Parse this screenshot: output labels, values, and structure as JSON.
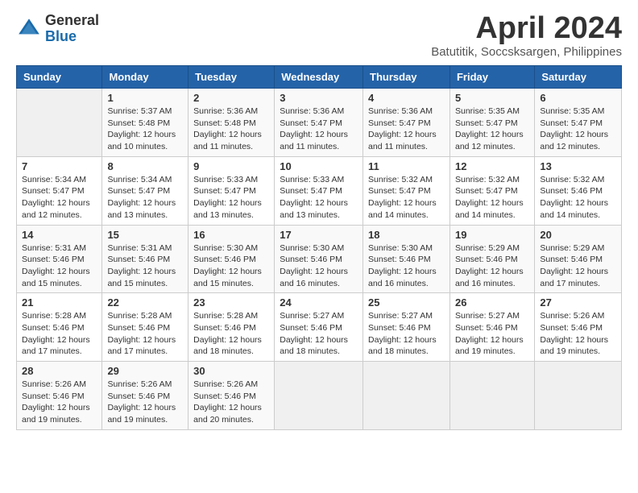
{
  "header": {
    "logo_general": "General",
    "logo_blue": "Blue",
    "month_year": "April 2024",
    "location": "Batutitik, Soccsksargen, Philippines"
  },
  "days_of_week": [
    "Sunday",
    "Monday",
    "Tuesday",
    "Wednesday",
    "Thursday",
    "Friday",
    "Saturday"
  ],
  "weeks": [
    [
      {
        "day": "",
        "empty": true
      },
      {
        "day": "1",
        "sunrise": "5:37 AM",
        "sunset": "5:48 PM",
        "daylight": "12 hours and 10 minutes."
      },
      {
        "day": "2",
        "sunrise": "5:36 AM",
        "sunset": "5:48 PM",
        "daylight": "12 hours and 11 minutes."
      },
      {
        "day": "3",
        "sunrise": "5:36 AM",
        "sunset": "5:47 PM",
        "daylight": "12 hours and 11 minutes."
      },
      {
        "day": "4",
        "sunrise": "5:36 AM",
        "sunset": "5:47 PM",
        "daylight": "12 hours and 11 minutes."
      },
      {
        "day": "5",
        "sunrise": "5:35 AM",
        "sunset": "5:47 PM",
        "daylight": "12 hours and 12 minutes."
      },
      {
        "day": "6",
        "sunrise": "5:35 AM",
        "sunset": "5:47 PM",
        "daylight": "12 hours and 12 minutes."
      }
    ],
    [
      {
        "day": "7",
        "sunrise": "5:34 AM",
        "sunset": "5:47 PM",
        "daylight": "12 hours and 12 minutes."
      },
      {
        "day": "8",
        "sunrise": "5:34 AM",
        "sunset": "5:47 PM",
        "daylight": "12 hours and 13 minutes."
      },
      {
        "day": "9",
        "sunrise": "5:33 AM",
        "sunset": "5:47 PM",
        "daylight": "12 hours and 13 minutes."
      },
      {
        "day": "10",
        "sunrise": "5:33 AM",
        "sunset": "5:47 PM",
        "daylight": "12 hours and 13 minutes."
      },
      {
        "day": "11",
        "sunrise": "5:32 AM",
        "sunset": "5:47 PM",
        "daylight": "12 hours and 14 minutes."
      },
      {
        "day": "12",
        "sunrise": "5:32 AM",
        "sunset": "5:47 PM",
        "daylight": "12 hours and 14 minutes."
      },
      {
        "day": "13",
        "sunrise": "5:32 AM",
        "sunset": "5:46 PM",
        "daylight": "12 hours and 14 minutes."
      }
    ],
    [
      {
        "day": "14",
        "sunrise": "5:31 AM",
        "sunset": "5:46 PM",
        "daylight": "12 hours and 15 minutes."
      },
      {
        "day": "15",
        "sunrise": "5:31 AM",
        "sunset": "5:46 PM",
        "daylight": "12 hours and 15 minutes."
      },
      {
        "day": "16",
        "sunrise": "5:30 AM",
        "sunset": "5:46 PM",
        "daylight": "12 hours and 15 minutes."
      },
      {
        "day": "17",
        "sunrise": "5:30 AM",
        "sunset": "5:46 PM",
        "daylight": "12 hours and 16 minutes."
      },
      {
        "day": "18",
        "sunrise": "5:30 AM",
        "sunset": "5:46 PM",
        "daylight": "12 hours and 16 minutes."
      },
      {
        "day": "19",
        "sunrise": "5:29 AM",
        "sunset": "5:46 PM",
        "daylight": "12 hours and 16 minutes."
      },
      {
        "day": "20",
        "sunrise": "5:29 AM",
        "sunset": "5:46 PM",
        "daylight": "12 hours and 17 minutes."
      }
    ],
    [
      {
        "day": "21",
        "sunrise": "5:28 AM",
        "sunset": "5:46 PM",
        "daylight": "12 hours and 17 minutes."
      },
      {
        "day": "22",
        "sunrise": "5:28 AM",
        "sunset": "5:46 PM",
        "daylight": "12 hours and 17 minutes."
      },
      {
        "day": "23",
        "sunrise": "5:28 AM",
        "sunset": "5:46 PM",
        "daylight": "12 hours and 18 minutes."
      },
      {
        "day": "24",
        "sunrise": "5:27 AM",
        "sunset": "5:46 PM",
        "daylight": "12 hours and 18 minutes."
      },
      {
        "day": "25",
        "sunrise": "5:27 AM",
        "sunset": "5:46 PM",
        "daylight": "12 hours and 18 minutes."
      },
      {
        "day": "26",
        "sunrise": "5:27 AM",
        "sunset": "5:46 PM",
        "daylight": "12 hours and 19 minutes."
      },
      {
        "day": "27",
        "sunrise": "5:26 AM",
        "sunset": "5:46 PM",
        "daylight": "12 hours and 19 minutes."
      }
    ],
    [
      {
        "day": "28",
        "sunrise": "5:26 AM",
        "sunset": "5:46 PM",
        "daylight": "12 hours and 19 minutes."
      },
      {
        "day": "29",
        "sunrise": "5:26 AM",
        "sunset": "5:46 PM",
        "daylight": "12 hours and 19 minutes."
      },
      {
        "day": "30",
        "sunrise": "5:26 AM",
        "sunset": "5:46 PM",
        "daylight": "12 hours and 20 minutes."
      },
      {
        "day": "",
        "empty": true
      },
      {
        "day": "",
        "empty": true
      },
      {
        "day": "",
        "empty": true
      },
      {
        "day": "",
        "empty": true
      }
    ]
  ]
}
